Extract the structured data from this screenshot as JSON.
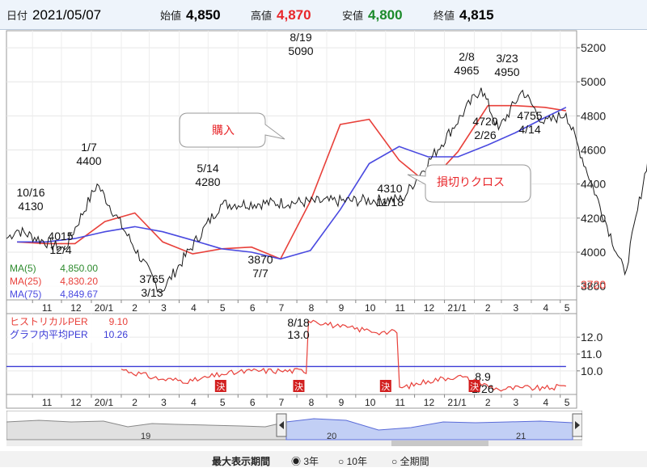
{
  "header": {
    "date_label": "日付",
    "date": "2021/05/07",
    "open_label": "始値",
    "open": "4,850",
    "high_label": "高値",
    "high": "4,870",
    "low_label": "安値",
    "low": "4,800",
    "close_label": "終値",
    "close": "4,815"
  },
  "colors": {
    "high": "#e8262a",
    "low": "#1b8a2a",
    "ma5": "#2e8b2e",
    "ma25": "#e8403a",
    "ma75": "#4a4ae0",
    "per_hist": "#e8403a",
    "per_avg": "#3b3bd6",
    "price_line": "#1a1a1a"
  },
  "main_panel": {
    "legend": [
      {
        "label": "MA(5)",
        "value": "4,850.00",
        "color": "#2e8b2e"
      },
      {
        "label": "MA(25)",
        "value": "4,830.20",
        "color": "#e8403a"
      },
      {
        "label": "MA(75)",
        "value": "4,849.67",
        "color": "#4a4ae0"
      }
    ],
    "y_ticks": [
      "5200",
      "5000",
      "4800",
      "4600",
      "4400",
      "4200",
      "4000",
      "3800"
    ],
    "y_low_label": "3720",
    "x_ticks": [
      "11",
      "12",
      "20/1",
      "2",
      "3",
      "4",
      "5",
      "6",
      "7",
      "8",
      "9",
      "10",
      "11",
      "12",
      "21/1",
      "2",
      "3",
      "4",
      "5"
    ],
    "annotations": [
      {
        "date": "10/16",
        "value": "4130"
      },
      {
        "date": "1/7",
        "value": "4400"
      },
      {
        "date": "12/4",
        "value": "4015"
      },
      {
        "date": "3/13",
        "value": "3765"
      },
      {
        "date": "5/14",
        "value": "4280"
      },
      {
        "date": "7/7",
        "value": "3870"
      },
      {
        "date": "8/19",
        "value": "5090"
      },
      {
        "date": "11/18",
        "value": "4310"
      },
      {
        "date": "2/8",
        "value": "4965"
      },
      {
        "date": "3/23",
        "value": "4950"
      },
      {
        "date": "2/26",
        "value": "4720"
      },
      {
        "date": "4/14",
        "value": "4755"
      }
    ],
    "callouts": {
      "buy": "購入",
      "cross": "損切りクロス"
    }
  },
  "per_panel": {
    "legend": [
      {
        "label": "ヒストリカルPER",
        "value": "9.10",
        "color": "#e8403a"
      },
      {
        "label": "グラフ内平均PER",
        "value": "10.26",
        "color": "#3b3bd6"
      }
    ],
    "y_ticks": [
      "12.0",
      "11.0",
      "10.0"
    ],
    "annotations": [
      {
        "date": "8/18",
        "value": "13.0"
      },
      {
        "date": "2/26",
        "value": "8.9"
      }
    ],
    "settle_label": "決",
    "x_ticks": [
      "11",
      "12",
      "20/1",
      "2",
      "3",
      "4",
      "5",
      "6",
      "7",
      "8",
      "9",
      "10",
      "11",
      "12",
      "21/1",
      "2",
      "3",
      "4",
      "5"
    ]
  },
  "navigator": {
    "labels": [
      "19",
      "20",
      "21"
    ]
  },
  "footer": {
    "period_label": "最大表示期間",
    "options": [
      "3年",
      "10年",
      "全期間"
    ]
  },
  "chart_data": {
    "type": "line",
    "title": "",
    "xlabel": "",
    "ylabel": "",
    "ylim": [
      3720,
      5300
    ],
    "series": [
      {
        "name": "MA(25)",
        "x": [
          "2019/10/16",
          "2019/11/15",
          "2019/12/15",
          "2020/1/15",
          "2020/2/15",
          "2020/3/15",
          "2020/4/15",
          "2020/5/15",
          "2020/6/15",
          "2020/7/15",
          "2020/8/15",
          "2020/9/15",
          "2020/10/15",
          "2020/11/15",
          "2020/12/15",
          "2021/1/15",
          "2021/2/15",
          "2021/3/15",
          "2021/4/15",
          "2021/5/7"
        ],
        "values": [
          4060,
          4050,
          4050,
          4180,
          4230,
          4060,
          3990,
          4020,
          4030,
          3960,
          4300,
          4750,
          4780,
          4540,
          4400,
          4590,
          4860,
          4860,
          4850,
          4830
        ]
      },
      {
        "name": "MA(75)",
        "x": [
          "2019/10/16",
          "2019/11/15",
          "2019/12/15",
          "2020/1/15",
          "2020/2/15",
          "2020/3/15",
          "2020/4/15",
          "2020/5/15",
          "2020/6/15",
          "2020/7/15",
          "2020/8/15",
          "2020/9/15",
          "2020/10/15",
          "2020/11/15",
          "2020/12/15",
          "2021/1/15",
          "2021/2/15",
          "2021/3/15",
          "2021/4/15",
          "2021/5/7"
        ],
        "values": [
          4060,
          4060,
          4080,
          4120,
          4150,
          4120,
          4070,
          4020,
          4000,
          3960,
          4010,
          4250,
          4520,
          4620,
          4560,
          4560,
          4630,
          4700,
          4790,
          4850
        ]
      }
    ],
    "per": {
      "x": [
        "2020/2/1",
        "2020/3/13",
        "2020/4/15",
        "2020/5/15",
        "2020/6/15",
        "2020/7/15",
        "2020/8/18",
        "2020/9/15",
        "2020/10/15",
        "2020/10/28",
        "2020/11/18",
        "2020/12/15",
        "2021/1/15",
        "2021/2/26",
        "2021/3/23",
        "2021/4/15",
        "2021/5/7"
      ],
      "historical": [
        10.1,
        9.5,
        9.4,
        9.8,
        10.0,
        10.0,
        13.0,
        12.6,
        12.4,
        12.3,
        9.0,
        9.4,
        9.7,
        8.9,
        9.0,
        8.95,
        9.1
      ],
      "average": 10.26,
      "ylim": [
        8.6,
        13.4
      ]
    }
  }
}
